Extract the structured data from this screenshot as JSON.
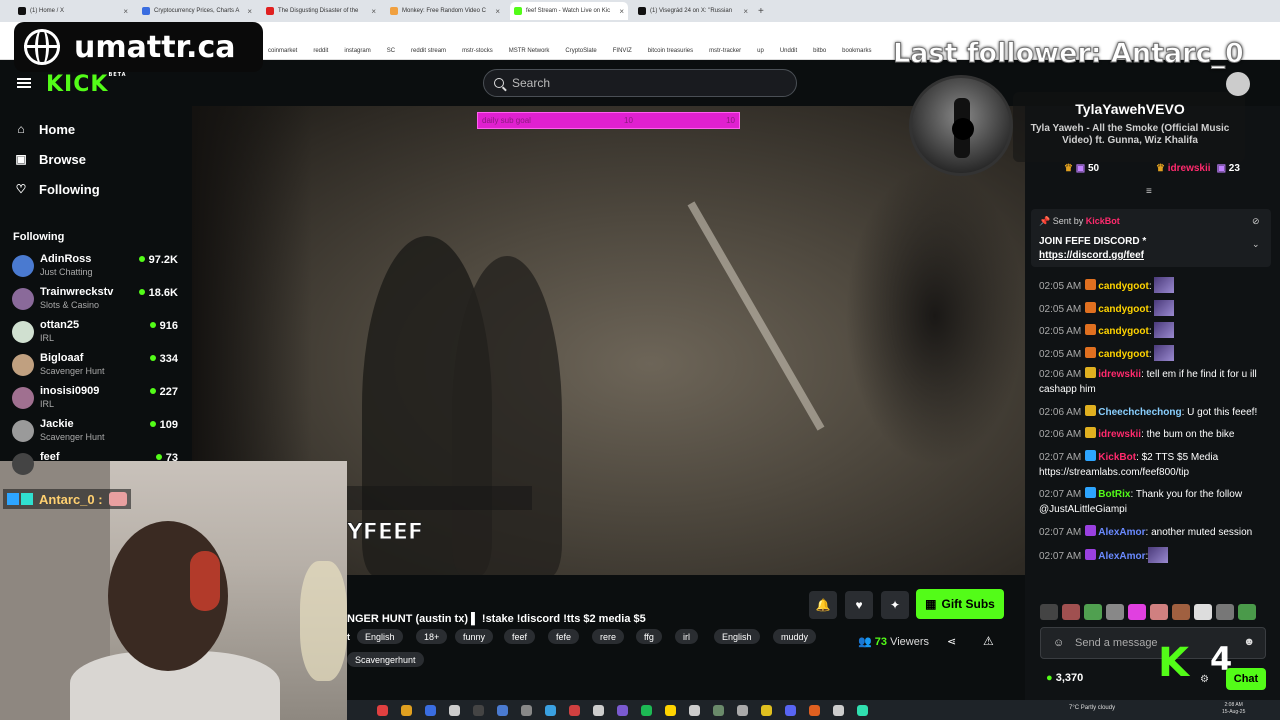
{
  "browser": {
    "tabs": [
      {
        "label": "(1) Home / X",
        "color": "#111111",
        "active": false
      },
      {
        "label": "Cryptocurrency Prices, Charts A",
        "color": "#3a6de0",
        "active": false
      },
      {
        "label": "The Disgusting Disaster of the",
        "color": "#e02020",
        "active": false
      },
      {
        "label": "Monkey: Free Random Video C",
        "color": "#f0a040",
        "active": false
      },
      {
        "label": "feef Stream - Watch Live on Kic",
        "color": "#53fc18",
        "active": true
      },
      {
        "label": "(1) Visegrád 24 on X: \"Russian",
        "color": "#111111",
        "active": false
      }
    ],
    "bookmarks": [
      "coinmarket",
      "reddit",
      "instagram",
      "SC",
      "reddit stream",
      "mstr-stocks",
      "MSTR Network",
      "CryptoSlate",
      "FINVIZ",
      "bitcoin treasuries",
      "mstr-tracker",
      "up",
      "Unddit",
      "bitbo",
      "bookmarks"
    ]
  },
  "overlay": {
    "site_badge": "umattr.ca",
    "last_follower": "Last follower: Antarc_0",
    "goal_text": "daily sub goal",
    "goal_current": "10",
    "goal_target": "10",
    "stream_logo": "YFEEF",
    "k_number": "4"
  },
  "header": {
    "logo": "KICK",
    "logo_sup": "BETA",
    "search_placeholder": "Search"
  },
  "sidebar": {
    "nav": [
      {
        "label": "Home",
        "icon": "home-icon",
        "glyph": "⌂"
      },
      {
        "label": "Browse",
        "icon": "browse-icon",
        "glyph": "▣"
      },
      {
        "label": "Following",
        "icon": "heart-icon",
        "glyph": "♡"
      }
    ],
    "following_label": "Following",
    "channels": [
      {
        "name": "AdinRoss",
        "category": "Just Chatting",
        "viewers": "97.2K",
        "color": "#4a7ad0"
      },
      {
        "name": "Trainwreckstv",
        "category": "Slots & Casino",
        "viewers": "18.6K",
        "color": "#8a6a9a"
      },
      {
        "name": "ottan25",
        "category": "IRL",
        "viewers": "916",
        "color": "#d0e0d0"
      },
      {
        "name": "Bigloaaf",
        "category": "Scavenger Hunt",
        "viewers": "334",
        "color": "#c0a080"
      },
      {
        "name": "inosisi0909",
        "category": "IRL",
        "viewers": "227",
        "color": "#a07090"
      },
      {
        "name": "Jackie",
        "category": "Scavenger Hunt",
        "viewers": "109",
        "color": "#9a9a9a"
      },
      {
        "name": "feef",
        "category": "",
        "viewers": "73",
        "color": "#444444"
      }
    ]
  },
  "webcam_chat": {
    "user": "Antarc_0 :"
  },
  "stream": {
    "title": "NGER HUNT (austin tx) ▌ !stake !discord !tts $2 media $5",
    "tag_lead": "t",
    "tags": [
      "English",
      "18+",
      "funny",
      "feef",
      "fefe",
      "rere",
      "ffg",
      "irl",
      "English",
      "muddy"
    ],
    "tags_row2": [
      "Scavengerhunt"
    ],
    "gift_label": "Gift Subs",
    "viewers_count": "73",
    "viewers_label": "Viewers"
  },
  "now_playing": {
    "artist": "TylaYawehVEVO",
    "song": "Tyla Yaweh - All the Smoke (Official Music Video) ft. Gunna, Wiz Khalifa"
  },
  "chat": {
    "leaderboard": [
      {
        "name": "",
        "count": "50"
      },
      {
        "name": "idrewskii",
        "count": "23"
      }
    ],
    "pinned": {
      "sent_by": "Sent by",
      "sender": "KickBot",
      "title": "JOIN FEFE DISCORD *",
      "link": "https://discord.gg/feef"
    },
    "messages": [
      {
        "time": "02:05 AM",
        "user": "candygoot",
        "color": "#ffd400",
        "text": "",
        "emote": true,
        "badge": "#e07020"
      },
      {
        "time": "02:05 AM",
        "user": "candygoot",
        "color": "#ffd400",
        "text": "",
        "emote": true,
        "badge": "#e07020"
      },
      {
        "time": "02:05 AM",
        "user": "candygoot",
        "color": "#ffd400",
        "text": "",
        "emote": true,
        "badge": "#e07020"
      },
      {
        "time": "02:05 AM",
        "user": "candygoot",
        "color": "#ffd400",
        "text": "",
        "emote": true,
        "badge": "#e07020"
      },
      {
        "time": "02:06 AM",
        "user": "idrewskii",
        "color": "#ff2a6d",
        "text": ": tell em if he find it for u ill cashapp him",
        "emote": false,
        "badge": "#e0b020"
      },
      {
        "time": "02:06 AM",
        "user": "Cheechchechong",
        "color": "#8ad0ff",
        "text": ": U got this feeef!",
        "emote": false,
        "badge": "#e0b020"
      },
      {
        "time": "02:06 AM",
        "user": "idrewskii",
        "color": "#ff2a6d",
        "text": ": the bum on the bike",
        "emote": false,
        "badge": "#e0b020"
      },
      {
        "time": "02:07 AM",
        "user": "KickBot",
        "color": "#ff2a6d",
        "text": ": $2 TTS $5 Media https://streamlabs.com/feef800/tip",
        "emote": false,
        "badge": "#2da5ff"
      },
      {
        "time": "02:07 AM",
        "user": "BotRix",
        "color": "#53fc18",
        "text": ": Thank you for the follow @JustALittleGiampi",
        "emote": false,
        "badge": "#2da5ff"
      },
      {
        "time": "02:07 AM",
        "user": "AlexAmor",
        "color": "#6a8aff",
        "text": ": another muted session",
        "emote": false,
        "badge": "#9a40e0"
      },
      {
        "time": "02:07 AM",
        "user": "AlexAmor",
        "color": "#6a8aff",
        "text": ":",
        "emote": true,
        "badge": "#9a40e0"
      }
    ],
    "input_placeholder": "Send a message",
    "points": "3,370",
    "send_label": "Chat"
  },
  "taskbar": {
    "weather": "7°C  Partly cloudy",
    "time": "2:08 AM",
    "date": "15-Aug-25"
  }
}
